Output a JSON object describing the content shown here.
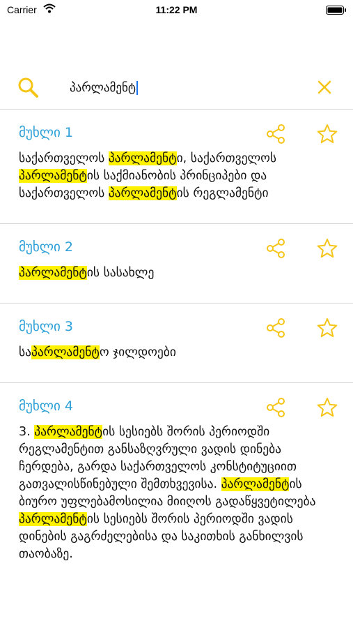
{
  "status_bar": {
    "carrier": "Carrier",
    "time": "11:22 PM",
    "icons": [
      "wifi-icon",
      "battery-icon"
    ]
  },
  "search": {
    "query": "პარლამენტ",
    "icons": [
      "search-icon",
      "close-icon"
    ],
    "accent_color": "#f5c518"
  },
  "highlight_color": "#fff200",
  "title_color": "#2a9fd8",
  "results": [
    {
      "title": "მუხლი 1",
      "segments": [
        {
          "t": "საქართველოს ",
          "h": false
        },
        {
          "t": "პარლამენტ",
          "h": true
        },
        {
          "t": "ი, საქართველოს ",
          "h": false
        },
        {
          "t": "პარლამენტ",
          "h": true
        },
        {
          "t": "ის საქმიანობის პრინციპები და საქართველოს ",
          "h": false
        },
        {
          "t": "პარლამენტ",
          "h": true
        },
        {
          "t": "ის რეგლამენტი",
          "h": false
        }
      ]
    },
    {
      "title": "მუხლი 2",
      "segments": [
        {
          "t": "პარლამენტ",
          "h": true
        },
        {
          "t": "ის სასახლე",
          "h": false
        }
      ]
    },
    {
      "title": "მუხლი 3",
      "segments": [
        {
          "t": "სა",
          "h": false
        },
        {
          "t": "პარლამენტ",
          "h": true
        },
        {
          "t": "ო ჯილდოები",
          "h": false
        }
      ]
    },
    {
      "title": "მუხლი 4",
      "segments": [
        {
          "t": "3. ",
          "h": false
        },
        {
          "t": "პარლამენტ",
          "h": true
        },
        {
          "t": "ის სესიებს შორის პერიოდში რეგლამენტით განსაზღვრული ვადის დინება ჩერდება, გარდა საქართველოს კონსტიტუციით გათვალისწინებული შემთხვევისა. ",
          "h": false
        },
        {
          "t": "პარლამენტ",
          "h": true
        },
        {
          "t": "ის ბიურო უფლებამოსილია მიიღოს გადაწყვეტილება ",
          "h": false
        },
        {
          "t": "პარლამენტ",
          "h": true
        },
        {
          "t": "ის სესიებს შორის პერიოდში ვადის დინების გაგრძელებისა და საკითხის განხილვის თაობაზე.",
          "h": false
        }
      ]
    }
  ]
}
